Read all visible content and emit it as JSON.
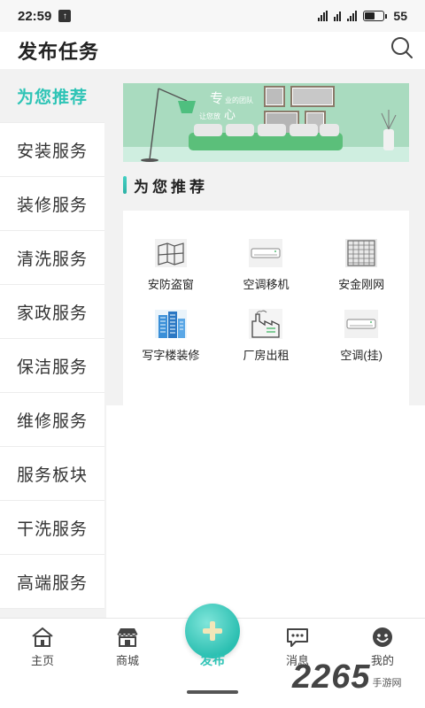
{
  "status_bar": {
    "time": "22:59",
    "battery": "55"
  },
  "header": {
    "title": "发布任务"
  },
  "left_nav": [
    {
      "label": "为您推荐",
      "active": true
    },
    {
      "label": "安装服务"
    },
    {
      "label": "装修服务"
    },
    {
      "label": "清洗服务"
    },
    {
      "label": "家政服务"
    },
    {
      "label": "保洁服务"
    },
    {
      "label": "维修服务"
    },
    {
      "label": "服务板块"
    },
    {
      "label": "干洗服务"
    },
    {
      "label": "高端服务"
    }
  ],
  "banner": {
    "big1": "专",
    "text1": "业的团队",
    "text2": "让您放",
    "big2": "心"
  },
  "section": {
    "title": "为您推荐"
  },
  "services": [
    {
      "label": "安防盗窗",
      "icon": "window-icon"
    },
    {
      "label": "空调移机",
      "icon": "air-conditioner-icon"
    },
    {
      "label": "安金刚网",
      "icon": "mesh-grid-icon"
    },
    {
      "label": "写字楼装修",
      "icon": "office-building-icon"
    },
    {
      "label": "厂房出租",
      "icon": "factory-icon"
    },
    {
      "label": "空调(挂)",
      "icon": "air-conditioner-icon"
    }
  ],
  "tabs": {
    "home": "主页",
    "mall": "商城",
    "publish": "发布",
    "messages": "消息",
    "mine": "我的"
  },
  "watermark": {
    "num": "2265",
    "sub": "手游网"
  },
  "colors": {
    "accent": "#2ec4b6",
    "background": "#f2f2f2"
  }
}
